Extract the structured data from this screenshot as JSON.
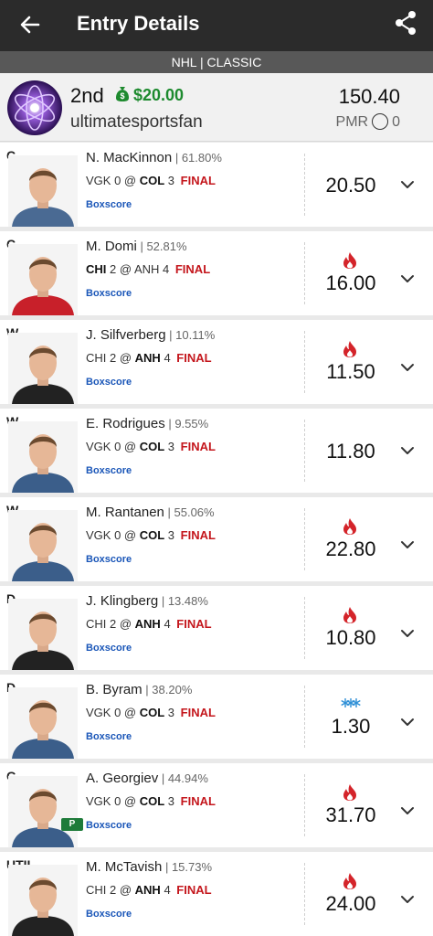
{
  "header": {
    "title": "Entry Details",
    "subtitle": "NHL | CLASSIC"
  },
  "entry": {
    "rank": "2nd",
    "prize": "$20.00",
    "username": "ultimatesportsfan",
    "score": "150.40",
    "pmr_label": "PMR",
    "pmr_value": "0"
  },
  "players": [
    {
      "pos": "C",
      "name": "N. MacKinnon",
      "pct": "61.80%",
      "team1": "VGK",
      "score1": "0",
      "team2": "COL",
      "score2": "3",
      "bold_team": 2,
      "status": "FINAL",
      "boxscore": "Boxscore",
      "points": "20.50",
      "trend": "none",
      "jersey": "#4a6a93"
    },
    {
      "pos": "C",
      "name": "M. Domi",
      "pct": "52.81%",
      "team1": "CHI",
      "score1": "2",
      "team2": "ANH",
      "score2": "4",
      "bold_team": 1,
      "status": "FINAL",
      "boxscore": "Boxscore",
      "points": "16.00",
      "trend": "hot",
      "jersey": "#c8202a"
    },
    {
      "pos": "W",
      "name": "J. Silfverberg",
      "pct": "10.11%",
      "team1": "CHI",
      "score1": "2",
      "team2": "ANH",
      "score2": "4",
      "bold_team": 2,
      "status": "FINAL",
      "boxscore": "Boxscore",
      "points": "11.50",
      "trend": "hot",
      "jersey": "#222222"
    },
    {
      "pos": "W",
      "name": "E. Rodrigues",
      "pct": "9.55%",
      "team1": "VGK",
      "score1": "0",
      "team2": "COL",
      "score2": "3",
      "bold_team": 2,
      "status": "FINAL",
      "boxscore": "Boxscore",
      "points": "11.80",
      "trend": "none",
      "jersey": "#3b5e8a"
    },
    {
      "pos": "W",
      "name": "M. Rantanen",
      "pct": "55.06%",
      "team1": "VGK",
      "score1": "0",
      "team2": "COL",
      "score2": "3",
      "bold_team": 2,
      "status": "FINAL",
      "boxscore": "Boxscore",
      "points": "22.80",
      "trend": "hot",
      "jersey": "#3b5e8a"
    },
    {
      "pos": "D",
      "name": "J. Klingberg",
      "pct": "13.48%",
      "team1": "CHI",
      "score1": "2",
      "team2": "ANH",
      "score2": "4",
      "bold_team": 2,
      "status": "FINAL",
      "boxscore": "Boxscore",
      "points": "10.80",
      "trend": "hot",
      "jersey": "#222222"
    },
    {
      "pos": "D",
      "name": "B. Byram",
      "pct": "38.20%",
      "team1": "VGK",
      "score1": "0",
      "team2": "COL",
      "score2": "3",
      "bold_team": 2,
      "status": "FINAL",
      "boxscore": "Boxscore",
      "points": "1.30",
      "trend": "cold",
      "jersey": "#3b5e8a"
    },
    {
      "pos": "G",
      "name": "A. Georgiev",
      "pct": "44.94%",
      "team1": "VGK",
      "score1": "0",
      "team2": "COL",
      "score2": "3",
      "bold_team": 2,
      "status": "FINAL",
      "boxscore": "Boxscore",
      "points": "31.70",
      "trend": "hot",
      "jersey": "#3b5e8a",
      "badge": "P"
    },
    {
      "pos": "UTIL",
      "name": "M. McTavish",
      "pct": "15.73%",
      "team1": "CHI",
      "score1": "2",
      "team2": "ANH",
      "score2": "4",
      "bold_team": 2,
      "status": "FINAL",
      "boxscore": "Boxscore",
      "points": "24.00",
      "trend": "hot",
      "jersey": "#222222"
    }
  ],
  "colors": {
    "topbar": "#2b2b2b",
    "subbar": "#585858",
    "final": "#c4161c",
    "prize": "#1d8a2e",
    "link": "#1a56b8",
    "hot": "#d4242a",
    "cold": "#2d8fd6"
  }
}
